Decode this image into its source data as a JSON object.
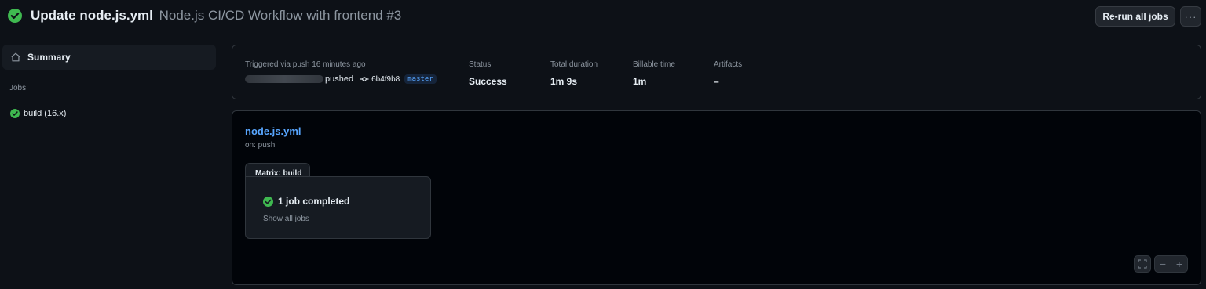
{
  "header": {
    "title": "Update node.js.yml",
    "subtitle": "Node.js CI/CD Workflow with frontend #3",
    "rerun_label": "Re-run all jobs",
    "more_label": "···",
    "status_icon": "check-circle-icon",
    "status_color": "#3fb950"
  },
  "sidebar": {
    "summary_label": "Summary",
    "summary_icon": "home-icon",
    "jobs_heading": "Jobs",
    "jobs": [
      {
        "label": "build (16.x)",
        "status": "success",
        "icon": "check-circle-icon"
      }
    ]
  },
  "summary": {
    "trigger_label": "Triggered via push 16 minutes ago",
    "pushed_text": "pushed",
    "commit_icon": "git-commit-icon",
    "commit_sha": "6b4f9b8",
    "branch": "master",
    "status_label": "Status",
    "status_value": "Success",
    "duration_label": "Total duration",
    "duration_value": "1m 9s",
    "billable_label": "Billable time",
    "billable_value": "1m",
    "artifacts_label": "Artifacts",
    "artifacts_value": "–"
  },
  "workflow": {
    "name": "node.js.yml",
    "trigger": "on: push",
    "matrix_label": "Matrix: build",
    "status_text": "1 job completed",
    "show_all_label": "Show all jobs"
  },
  "graph_controls": {
    "fullscreen_icon": "fullscreen-icon",
    "zoom_out_label": "−",
    "zoom_in_label": "+"
  },
  "colors": {
    "background": "#0d1117",
    "accent_link": "#58a6ff",
    "success": "#3fb950",
    "border": "#30363d"
  }
}
